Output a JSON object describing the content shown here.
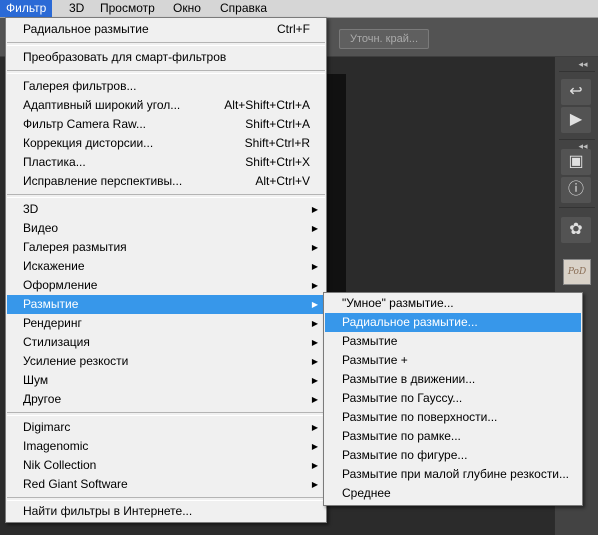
{
  "menubar": {
    "filter": "Фильтр",
    "d3": "3D",
    "view": "Просмотр",
    "window": "Окно",
    "help": "Справка"
  },
  "options_bar": {
    "refine_edge": "Уточн. край..."
  },
  "right_panel": {
    "collapse": "◂◂",
    "icons": [
      "history-icon",
      "play-icon",
      "3d-cube-icon",
      "info-icon",
      "palette-icon"
    ],
    "thumbnail": "PoD"
  },
  "filter_menu": {
    "last_filter": {
      "label": "Радиальное размытие",
      "shortcut": "Ctrl+F"
    },
    "smart": "Преобразовать для смарт-фильтров",
    "group1": [
      {
        "label": "Галерея фильтров...",
        "shortcut": ""
      },
      {
        "label": "Адаптивный широкий угол...",
        "shortcut": "Alt+Shift+Ctrl+A"
      },
      {
        "label": "Фильтр Camera Raw...",
        "shortcut": "Shift+Ctrl+A"
      },
      {
        "label": "Коррекция дисторсии...",
        "shortcut": "Shift+Ctrl+R"
      },
      {
        "label": "Пластика...",
        "shortcut": "Shift+Ctrl+X"
      },
      {
        "label": "Исправление перспективы...",
        "shortcut": "Alt+Ctrl+V"
      }
    ],
    "group2": [
      "3D",
      "Видео",
      "Галерея размытия",
      "Искажение",
      "Оформление",
      "Размытие",
      "Рендеринг",
      "Стилизация",
      "Усиление резкости",
      "Шум",
      "Другое"
    ],
    "group3": [
      "Digimarc",
      "Imagenomic",
      "Nik Collection",
      "Red Giant Software"
    ],
    "online": "Найти фильтры в Интернете...",
    "submenu_arrow": "▶"
  },
  "blur_submenu": {
    "items": [
      "\"Умное\" размытие...",
      "Радиальное размытие...",
      "Размытие",
      "Размытие +",
      "Размытие в движении...",
      "Размытие по Гауссу...",
      "Размытие по поверхности...",
      "Размытие по рамке...",
      "Размытие по фигуре...",
      "Размытие при малой глубине резкости...",
      "Среднее"
    ],
    "highlighted": "Радиальное размытие..."
  },
  "colors": {
    "highlight": "#3797ea",
    "menubar_active": "#2b6ad6",
    "menu_bg": "#f0f0f0"
  }
}
